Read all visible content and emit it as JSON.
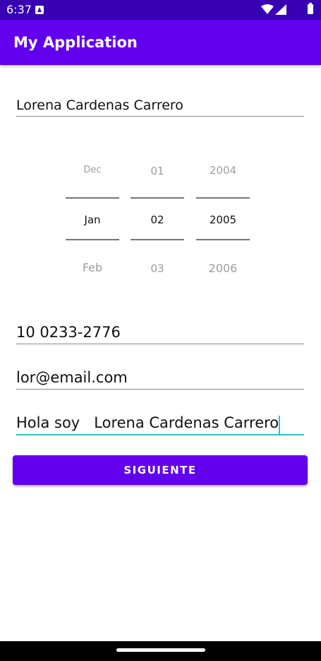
{
  "status_bar": {
    "time": "6:37",
    "notification_icon": "a-notification-icon",
    "icons": [
      "wifi-icon",
      "signal-icon",
      "battery-icon"
    ]
  },
  "app_bar": {
    "title": "My Application"
  },
  "form": {
    "name_value": "Lorena Cardenas Carrero",
    "date_picker": {
      "months": {
        "prev": "Dec",
        "selected": "Jan",
        "next": "Feb"
      },
      "days": {
        "prev": "01",
        "selected": "02",
        "next": "03"
      },
      "years": {
        "prev": "2004",
        "selected": "2005",
        "next": "2006"
      }
    },
    "phone_value": "10 0233-2776",
    "email_value": "lor@email.com",
    "description_value": "Hola soy   Lorena Cardenas Carrero",
    "next_button_label": "SIGUIENTE"
  },
  "colors": {
    "primary": "#6200ee",
    "primary_dark": "#3700b3",
    "focus_accent": "#26c6c6"
  }
}
